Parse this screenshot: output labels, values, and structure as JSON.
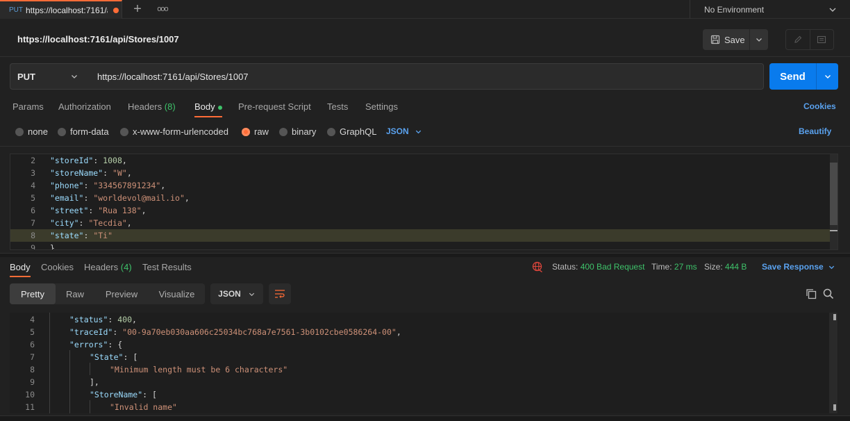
{
  "tab": {
    "method": "PUT",
    "title": "https://localhost:7161/a"
  },
  "environment": {
    "label": "No Environment"
  },
  "request": {
    "title": "https://localhost:7161/api/Stores/1007",
    "save_label": "Save",
    "method": "PUT",
    "url": "https://localhost:7161/api/Stores/1007",
    "send_label": "Send"
  },
  "request_tabs": [
    {
      "label": "Params"
    },
    {
      "label": "Authorization"
    },
    {
      "label": "Headers",
      "count": "(8)"
    },
    {
      "label": "Body"
    },
    {
      "label": "Pre-request Script"
    },
    {
      "label": "Tests"
    },
    {
      "label": "Settings"
    }
  ],
  "cookies_label": "Cookies",
  "body_types": [
    "none",
    "form-data",
    "x-www-form-urlencoded",
    "raw",
    "binary",
    "GraphQL"
  ],
  "body_selected": "raw",
  "body_format": "JSON",
  "beautify_label": "Beautify",
  "request_body": [
    {
      "ln": "2",
      "key": "\"storeId\"",
      "value": "1008",
      "vtype": "n",
      "tail": ","
    },
    {
      "ln": "3",
      "key": "\"storeName\"",
      "value": "\"W\"",
      "vtype": "s",
      "tail": ","
    },
    {
      "ln": "4",
      "key": "\"phone\"",
      "value": "\"334567891234\"",
      "vtype": "s",
      "tail": ","
    },
    {
      "ln": "5",
      "key": "\"email\"",
      "value": "\"worldevol@mail.io\"",
      "vtype": "s",
      "tail": ","
    },
    {
      "ln": "6",
      "key": "\"street\"",
      "value": "\"Rua 138\"",
      "vtype": "s",
      "tail": ","
    },
    {
      "ln": "7",
      "key": "\"city\"",
      "value": "\"Tecdia\"",
      "vtype": "s",
      "tail": ","
    },
    {
      "ln": "8",
      "key": "\"state\"",
      "value": "\"Ti\"",
      "vtype": "s",
      "tail": ""
    },
    {
      "ln": "9",
      "key": "",
      "value": "}",
      "vtype": "p",
      "tail": ""
    }
  ],
  "response_tabs": [
    {
      "label": "Body"
    },
    {
      "label": "Cookies"
    },
    {
      "label": "Headers",
      "count": "(4)"
    },
    {
      "label": "Test Results"
    }
  ],
  "response_status": {
    "status_label": "Status:",
    "status_value": "400 Bad Request",
    "time_label": "Time:",
    "time_value": "27 ms",
    "size_label": "Size:",
    "size_value": "444 B",
    "save_response_label": "Save Response"
  },
  "view_modes": [
    "Pretty",
    "Raw",
    "Preview",
    "Visualize"
  ],
  "view_selected": "Pretty",
  "response_format": "JSON",
  "response_body": [
    {
      "ln": "4",
      "indent": 1,
      "key": "\"status\"",
      "value": "400",
      "vtype": "n",
      "tail": ","
    },
    {
      "ln": "5",
      "indent": 1,
      "key": "\"traceId\"",
      "value": "\"00-9a70eb030aa606c25034bc768a7e7561-3b0102cbe0586264-00\"",
      "vtype": "s",
      "tail": ","
    },
    {
      "ln": "6",
      "indent": 1,
      "key": "\"errors\"",
      "value": "{",
      "vtype": "p",
      "tail": ""
    },
    {
      "ln": "7",
      "indent": 2,
      "key": "\"State\"",
      "value": "[",
      "vtype": "p",
      "tail": ""
    },
    {
      "ln": "8",
      "indent": 3,
      "key": "",
      "value": "\"Minimum length must be 6 characters\"",
      "vtype": "s",
      "tail": ""
    },
    {
      "ln": "9",
      "indent": 2,
      "key": "",
      "value": "],",
      "vtype": "p",
      "tail": ""
    },
    {
      "ln": "10",
      "indent": 2,
      "key": "\"StoreName\"",
      "value": "[",
      "vtype": "p",
      "tail": ""
    },
    {
      "ln": "11",
      "indent": 3,
      "key": "",
      "value": "\"Invalid name\"",
      "vtype": "s",
      "tail": ""
    }
  ]
}
